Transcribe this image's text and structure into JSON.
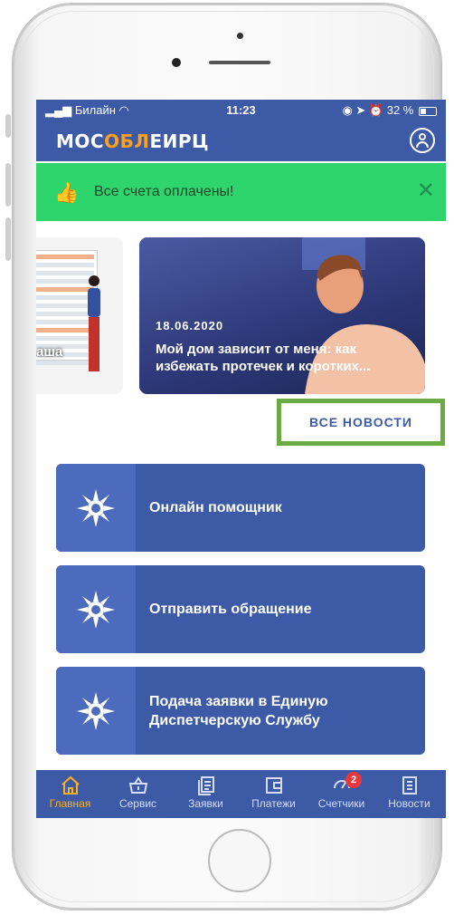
{
  "status": {
    "carrier": "Билайн",
    "time": "11:23",
    "battery": "32 %"
  },
  "header": {
    "logo_part1": "МОС",
    "logo_accent": "ОБЛ",
    "logo_part2": "ЕИРЦ"
  },
  "notice": {
    "text": "Все счета оплачены!"
  },
  "news": [
    {
      "title_fragment": "аша"
    },
    {
      "date": "18.06.2020",
      "title": "Мой дом зависит от меня: как избежать протечек и коротких..."
    }
  ],
  "all_news_button": "ВСЕ НОВОСТИ",
  "actions": [
    {
      "label": "Онлайн помощник"
    },
    {
      "label": "Отправить обращение"
    },
    {
      "label": "Подача заявки в Единую Диспетчерскую Службу"
    }
  ],
  "tabs": [
    {
      "label": "Главная",
      "icon": "home-icon",
      "active": true
    },
    {
      "label": "Сервис",
      "icon": "basket-icon"
    },
    {
      "label": "Заявки",
      "icon": "requests-icon"
    },
    {
      "label": "Платежи",
      "icon": "wallet-icon"
    },
    {
      "label": "Счетчики",
      "icon": "meter-icon",
      "badge": "2"
    },
    {
      "label": "Новости",
      "icon": "news-icon"
    }
  ],
  "colors": {
    "primary": "#3d5aa6",
    "notice": "#2ed46c",
    "accent": "#ffb01f",
    "highlight": "#6bab43"
  }
}
